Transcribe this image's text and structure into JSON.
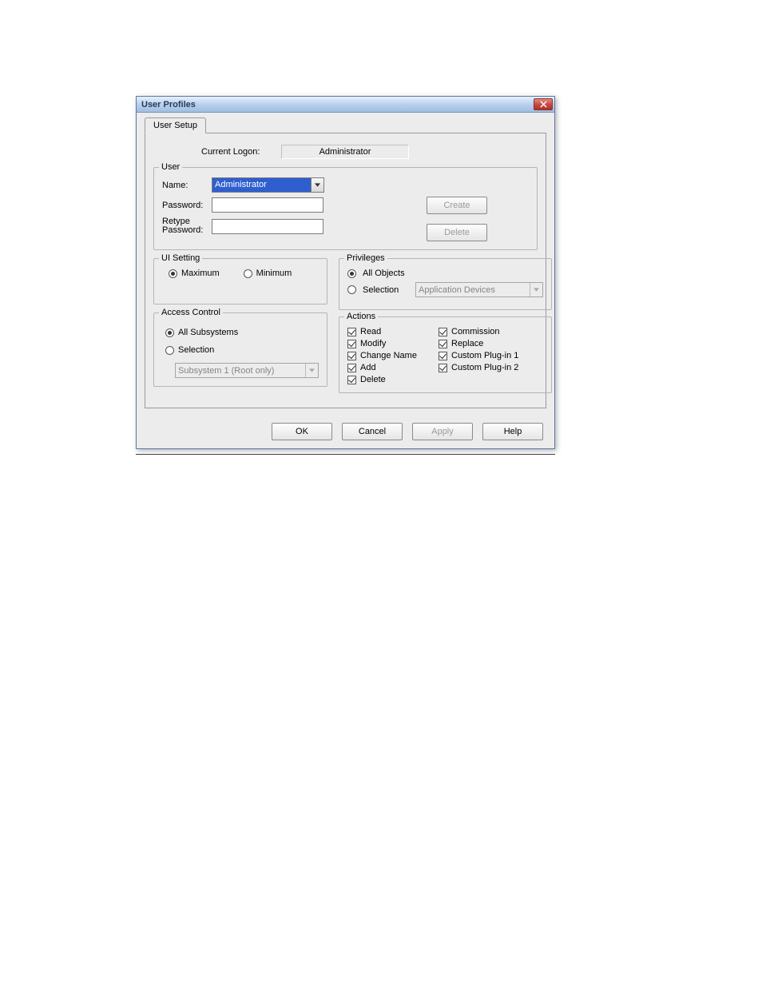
{
  "dialog": {
    "title": "User Profiles",
    "tab_label": "User Setup",
    "current_logon_label": "Current Logon:",
    "current_logon_value": "Administrator"
  },
  "user": {
    "legend": "User",
    "name_label": "Name:",
    "name_value": "Administrator",
    "password_label": "Password:",
    "retype_label": "Retype Password:",
    "create_btn": "Create",
    "delete_btn": "Delete"
  },
  "ui_setting": {
    "legend": "UI Setting",
    "maximum": "Maximum",
    "minimum": "Minimum"
  },
  "access_control": {
    "legend": "Access Control",
    "all_subsystems": "All Subsystems",
    "selection": "Selection",
    "subsystem_value": "Subsystem 1 (Root only)"
  },
  "privileges": {
    "legend": "Privileges",
    "all_objects": "All Objects",
    "selection": "Selection",
    "selection_value": "Application Devices"
  },
  "actions": {
    "legend": "Actions",
    "read": "Read",
    "modify": "Modify",
    "change_name": "Change Name",
    "add": "Add",
    "delete": "Delete",
    "commission": "Commission",
    "replace": "Replace",
    "custom1": "Custom Plug-in 1",
    "custom2": "Custom Plug-in 2"
  },
  "buttons": {
    "ok": "OK",
    "cancel": "Cancel",
    "apply": "Apply",
    "help": "Help"
  }
}
